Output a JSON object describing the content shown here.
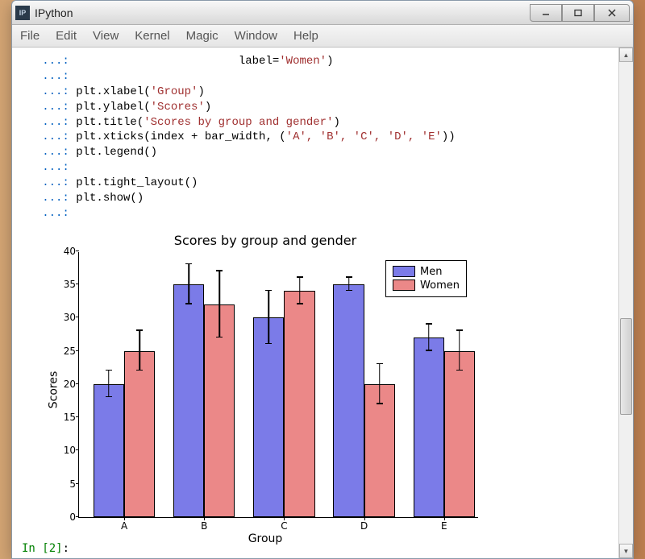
{
  "window": {
    "title": "IPython"
  },
  "menubar": {
    "items": [
      "File",
      "Edit",
      "View",
      "Kernel",
      "Magic",
      "Window",
      "Help"
    ]
  },
  "code": {
    "cont_prompt": "   ...: ",
    "lines": [
      {
        "indent": "                        ",
        "text": "label=",
        "str": "'Women'",
        "tail": ")"
      },
      {
        "text": ""
      },
      {
        "text": "plt.xlabel(",
        "str": "'Group'",
        "tail": ")"
      },
      {
        "text": "plt.ylabel(",
        "str": "'Scores'",
        "tail": ")"
      },
      {
        "text": "plt.title(",
        "str": "'Scores by group and gender'",
        "tail": ")"
      },
      {
        "text": "plt.xticks(index + bar_width, (",
        "str": "'A', 'B', 'C', 'D', 'E'",
        "tail": "))"
      },
      {
        "text": "plt.legend()"
      },
      {
        "text": ""
      },
      {
        "text": "plt.tight_layout()"
      },
      {
        "text": "plt.show()"
      },
      {
        "text": ""
      }
    ]
  },
  "input_prompt": {
    "in_label": "In ",
    "num": "[2]",
    "colon": ":"
  },
  "chart_data": {
    "type": "bar",
    "title": "Scores by group and gender",
    "xlabel": "Group",
    "ylabel": "Scores",
    "ylim": [
      0,
      40
    ],
    "yticks": [
      0,
      5,
      10,
      15,
      20,
      25,
      30,
      35,
      40
    ],
    "categories": [
      "A",
      "B",
      "C",
      "D",
      "E"
    ],
    "series": [
      {
        "name": "Men",
        "color": "#7b7be8",
        "values": [
          20,
          35,
          30,
          35,
          27
        ],
        "errors": [
          2,
          3,
          4,
          1,
          2
        ]
      },
      {
        "name": "Women",
        "color": "#eb8888",
        "values": [
          25,
          32,
          34,
          20,
          25
        ],
        "errors": [
          3,
          5,
          2,
          3,
          3
        ]
      }
    ],
    "bar_width": 0.35,
    "legend_position": "upper right"
  }
}
